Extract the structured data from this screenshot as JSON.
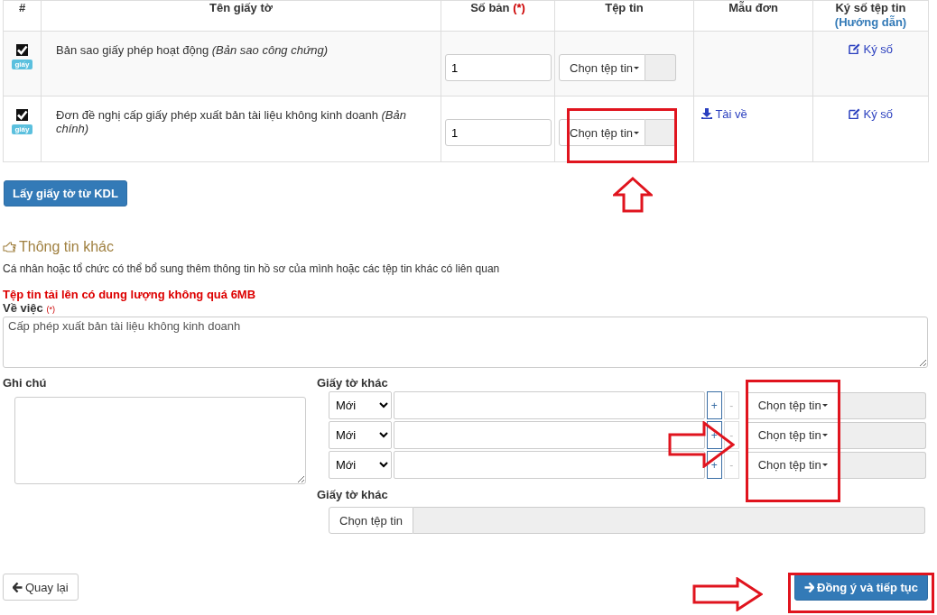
{
  "documents_table": {
    "columns": [
      {
        "label": "#"
      },
      {
        "label": "Tên giấy tờ"
      },
      {
        "label": "Số bản",
        "required_mark": "(*)"
      },
      {
        "label": "Tệp tin"
      },
      {
        "label": "Mẫu đơn"
      },
      {
        "label": "Ký số tệp tin",
        "link": "(Hướng dẫn)"
      }
    ],
    "rows": [
      {
        "checked": true,
        "badge": "giấy",
        "name": "Bản sao giấy phép hoạt động *(Bản sao công chứng)*",
        "copies": "1",
        "file_button": "Chọn tệp tin",
        "sign_link": "Ký số"
      },
      {
        "checked": true,
        "badge": "giấy",
        "name": "Đơn đề nghị cấp giấy phép xuất bản tài liệu không kinh doanh *(Bản chính)*",
        "copies": "1",
        "file_button": "Chọn tệp tin",
        "template_link": "Tài về",
        "sign_link": "Ký số"
      }
    ]
  },
  "fetch_button": "Lấy giấy tờ từ KDL",
  "other_info": {
    "title": "Thông tin khác",
    "description": "Cá nhân hoặc tổ chức có thể bổ sung thêm thông tin hồ sơ của mình hoặc các tệp tin khác có liên quan",
    "size_warning": "Tệp tin tải lên có dung lượng không quá 6MB",
    "subject_label": "Về việc",
    "subject_required": "(*)",
    "subject_value": "Cấp phép xuất bản tài liệu không kinh doanh",
    "note_label": "Ghi chú",
    "other_docs_label": "Giấy tờ khác",
    "other_docs": [
      {
        "type": "Mới",
        "add": "+",
        "remove": "-",
        "remove_disabled": true,
        "file_button": "Chọn tệp tin"
      },
      {
        "type": "Mới",
        "add": "+",
        "remove": "-",
        "remove_disabled": true,
        "file_button": "Chọn tệp tin"
      },
      {
        "type": "Mới",
        "add": "+",
        "remove": "-",
        "remove_disabled": true,
        "file_button": "Chọn tệp tin"
      }
    ],
    "other_docs_label_2": "Giấy tờ khác",
    "single_file_button": "Chọn tệp tin"
  },
  "back_button": "Quay lại",
  "continue_button": "Đồng ý và tiếp tục"
}
